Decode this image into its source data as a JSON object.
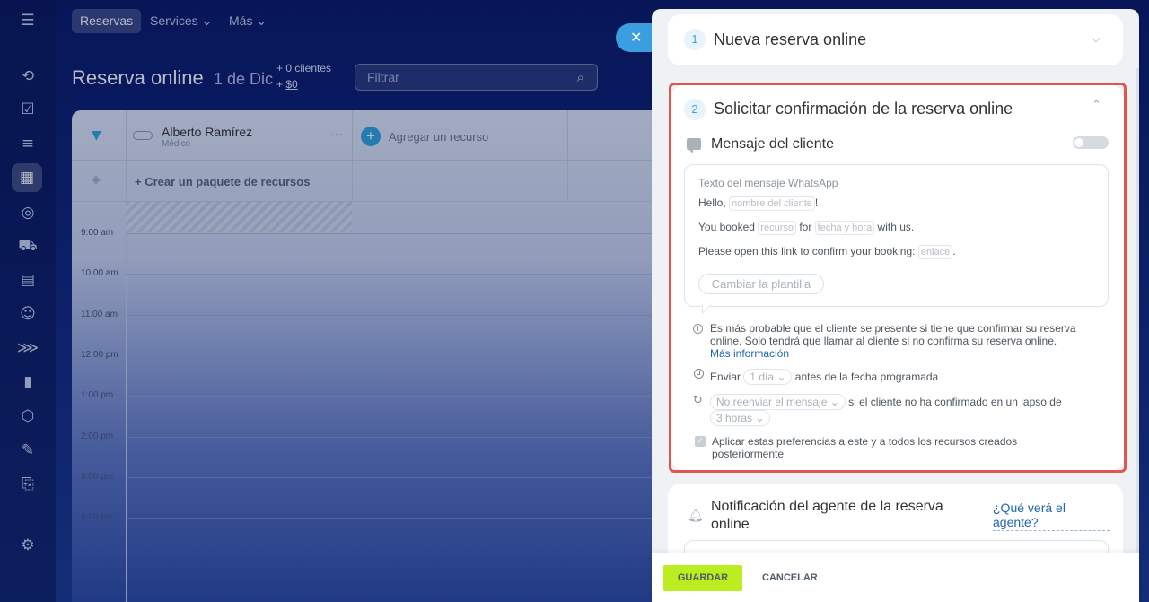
{
  "topnav": {
    "items": [
      {
        "label": "Reservas",
        "active": true
      },
      {
        "label": "Services ⌄",
        "active": false
      },
      {
        "label": "Más ⌄",
        "active": false
      }
    ]
  },
  "page": {
    "title": "Reserva online",
    "date": "1 de Dic",
    "clients": "+ 0 clientes",
    "money_prefix": "+ ",
    "money": "$0",
    "filter_placeholder": "Filtrar"
  },
  "calendar": {
    "resource_name": "Alberto Ramírez",
    "resource_role": "Médico",
    "add_resource": "Agregar un recurso",
    "create_package": "+ Crear un paquete de recursos",
    "times": [
      "9:00 am",
      "10:00 am",
      "11:00 am",
      "12:00 pm",
      "1:00 pm",
      "2:00 pm",
      "3:00 pm",
      "4:00 pm"
    ]
  },
  "panel": {
    "step1": {
      "num": "1",
      "title": "Nueva reserva online"
    },
    "step2": {
      "num": "2",
      "title": "Solicitar confirmación de la reserva online"
    },
    "client_message": {
      "title": "Mensaje del cliente",
      "enabled": false,
      "box_label": "Texto del mensaje WhatsApp",
      "line1_pre": "Hello, ",
      "line1_chip": "nombre del cliente",
      "line1_post": "!",
      "line2_pre": "You booked ",
      "line2_chip1": "recurso",
      "line2_mid1": " for ",
      "line2_chip2": "fecha y hora",
      "line2_post": " with us.",
      "line3_pre": "Please open this link to confirm your booking: ",
      "line3_chip": "enlace",
      "line3_post": ".",
      "change_template": "Cambiar la plantilla"
    },
    "info_text": "Es más probable que el cliente se presente si tiene que confirmar su reserva online. Solo tendrá que llamar al cliente si no confirma su reserva online.",
    "info_link": "Más información",
    "send": {
      "pre": "Enviar",
      "value": "1 día ⌄",
      "post": "antes de la fecha programada"
    },
    "resend": {
      "value": "No reenviar el mensaje ⌄",
      "post": "si el cliente no ha confirmado en un lapso de",
      "period": "3 horas ⌄"
    },
    "apply_all": {
      "label": "Aplicar estas preferencias a este y a todos los recursos creados posteriormente",
      "checked": true
    },
    "notification": {
      "title": "Notificación del agente de la reserva online",
      "link": "¿Qué verá el agente?"
    },
    "footer": {
      "save": "GUARDAR",
      "cancel": "CANCELAR"
    }
  },
  "colors": {
    "accent": "#3ba3de",
    "save": "#bbed21",
    "highlight": "#e0574f",
    "link": "#2066b0"
  }
}
